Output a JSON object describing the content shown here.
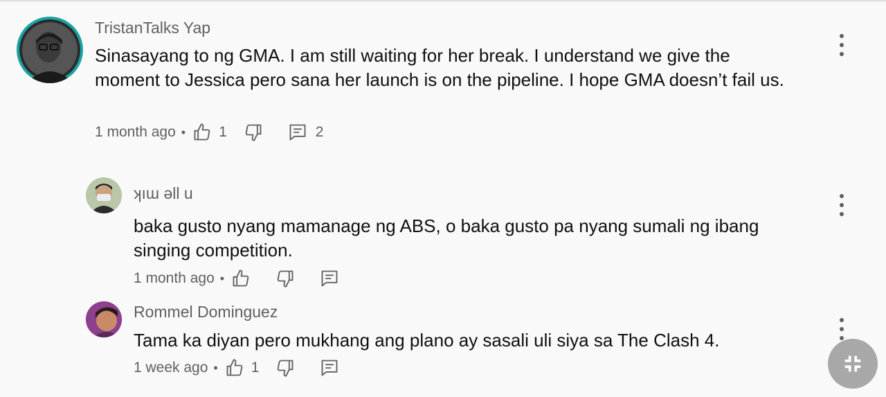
{
  "comments": [
    {
      "author": "TristanTalks Yap",
      "text": "Sinasayang to ng GMA. I am still waiting for her break. I understand we give the moment to Jessica pero sana her launch is on the pipeline. I hope GMA doesn’t fail us.",
      "time": "1 month ago",
      "likes": "1",
      "replies": "2"
    }
  ],
  "replies": [
    {
      "author": "ʞıɯ ǝll u",
      "text": "baka gusto nyang mamanage ng ABS, o baka gusto pa nyang sumali ng ibang singing competition.",
      "time": "1 month ago",
      "likes": ""
    },
    {
      "author": "Rommel Dominguez",
      "text": "Tama ka diyan pero mukhang ang plano ay sasali uli siya sa The Clash 4.",
      "time": "1 week ago",
      "likes": "1"
    }
  ],
  "meta_separator": "•",
  "icons": {
    "like": "thumb-up-icon",
    "dislike": "thumb-down-icon",
    "reply": "comment-icon",
    "more": "more-vert-icon",
    "exit_fullscreen": "fullscreen-exit-icon"
  },
  "colors": {
    "background": "#f9f9f9",
    "text_primary": "#0f0f0f",
    "text_secondary": "#606060",
    "avatar_ring": "#1aa3a3",
    "fab": "#a8a8a8"
  }
}
